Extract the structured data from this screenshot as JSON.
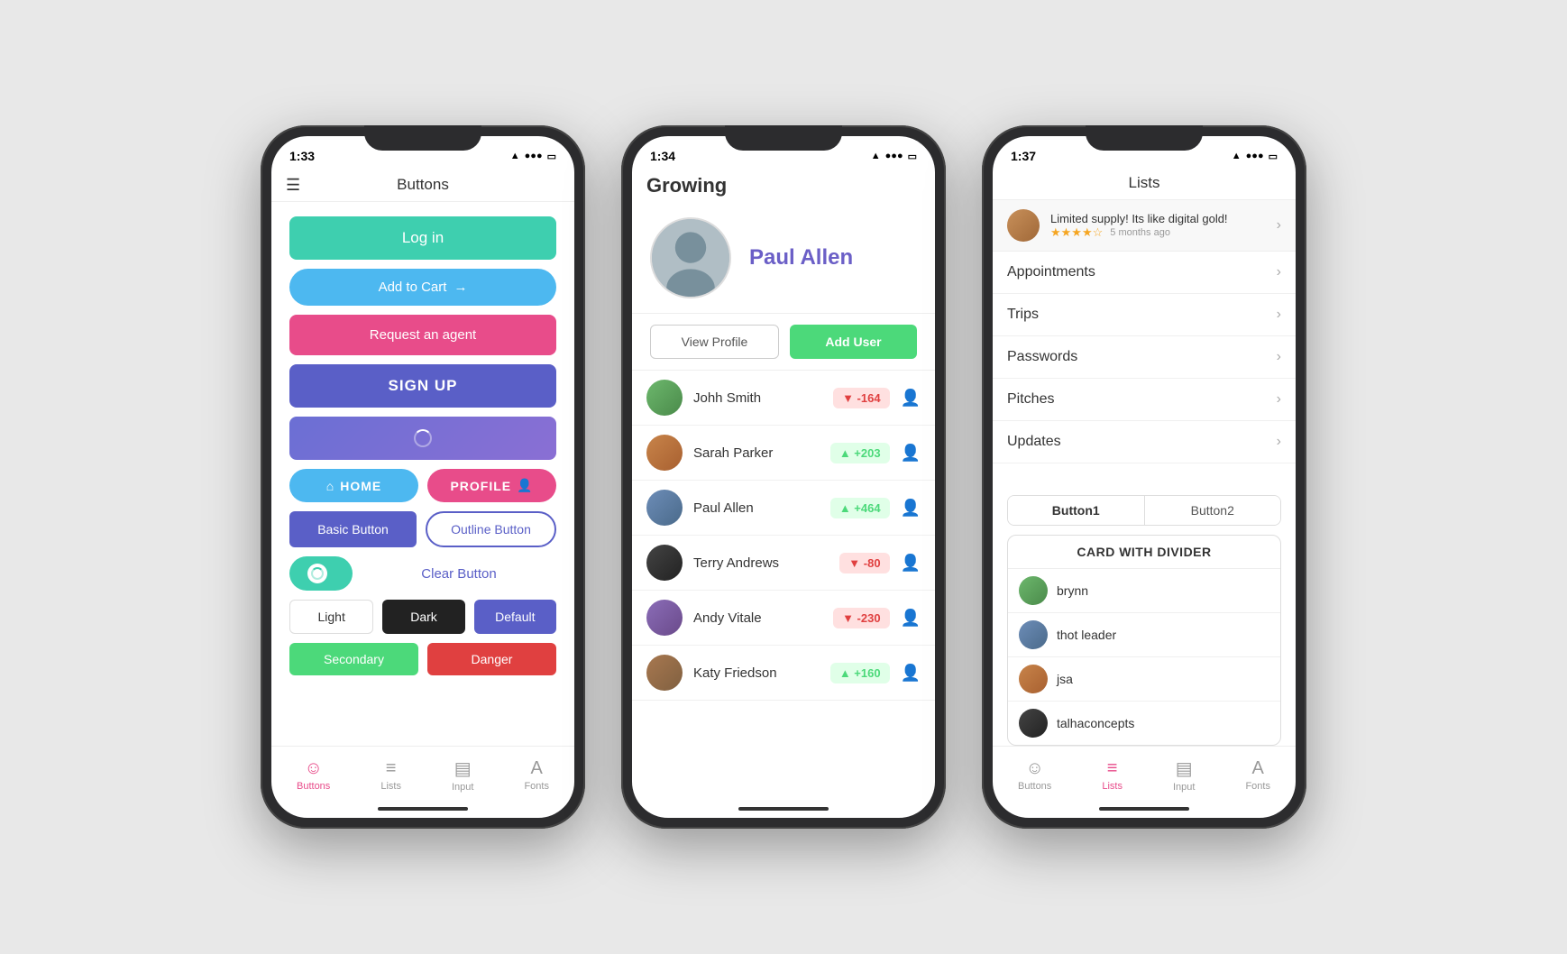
{
  "phone1": {
    "status_time": "1:33",
    "title": "Buttons",
    "buttons": {
      "login": "Log in",
      "addcart": "Add to Cart",
      "agent": "Request an agent",
      "signup": "SIGN UP",
      "home": "HOME",
      "profile": "PROFILE",
      "basic": "Basic Button",
      "outline": "Outline Button",
      "clear": "Clear Button",
      "light": "Light",
      "dark": "Dark",
      "default": "Default",
      "secondary": "Secondary",
      "danger": "Danger"
    },
    "nav": {
      "buttons": "Buttons",
      "lists": "Lists",
      "input": "Input",
      "fonts": "Fonts"
    }
  },
  "phone2": {
    "status_time": "1:34",
    "app_name": "Growing",
    "profile": {
      "name": "Paul Allen"
    },
    "buttons": {
      "view_profile": "View Profile",
      "add_user": "Add User"
    },
    "users": [
      {
        "name": "Johh Smith",
        "score": "-164",
        "positive": false
      },
      {
        "name": "Sarah Parker",
        "score": "+203",
        "positive": true
      },
      {
        "name": "Paul Allen",
        "score": "+464",
        "positive": true
      },
      {
        "name": "Terry Andrews",
        "score": "-80",
        "positive": false
      },
      {
        "name": "Andy Vitale",
        "score": "-230",
        "positive": false
      },
      {
        "name": "Katy Friedson",
        "score": "+160",
        "positive": true
      }
    ]
  },
  "phone3": {
    "status_time": "1:37",
    "title": "Lists",
    "review": {
      "text": "Limited supply! Its like digital gold!",
      "stars": "★★★★☆",
      "time": "5 months ago"
    },
    "list_items": [
      "Appointments",
      "Trips",
      "Passwords",
      "Pitches",
      "Updates"
    ],
    "tabs": [
      "Button1",
      "Button2"
    ],
    "card_title": "CARD WITH DIVIDER",
    "card_users": [
      "brynn",
      "thot leader",
      "jsa",
      "talhaconcepts"
    ],
    "nav": {
      "buttons": "Buttons",
      "lists": "Lists",
      "input": "Input",
      "fonts": "Fonts"
    }
  }
}
